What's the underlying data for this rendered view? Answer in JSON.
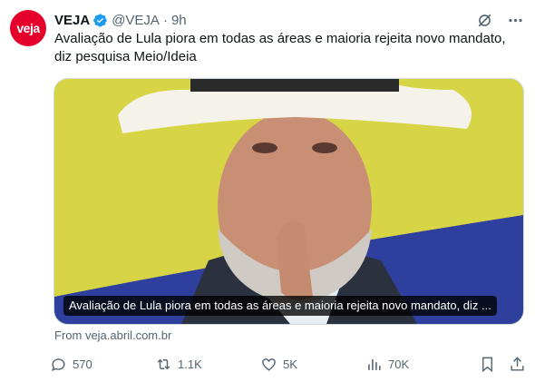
{
  "tweet": {
    "avatar_text": "veja",
    "name": "VEJA",
    "handle": "@VEJA",
    "separator": "·",
    "time": "9h",
    "text": "Avaliação de Lula piora em todas as áreas e maioria rejeita novo mandato, diz pesquisa Meio/Ideia",
    "card_caption": "Avaliação de Lula piora em todas as áreas e maioria rejeita novo mandato, diz ...",
    "source": "From veja.abril.com.br"
  },
  "metrics": {
    "replies": "570",
    "reposts": "1.1K",
    "likes": "5K",
    "views": "70K"
  },
  "colors": {
    "brand": "#e4002b",
    "verified": "#1d9bf0",
    "secondary_text": "#536471"
  }
}
